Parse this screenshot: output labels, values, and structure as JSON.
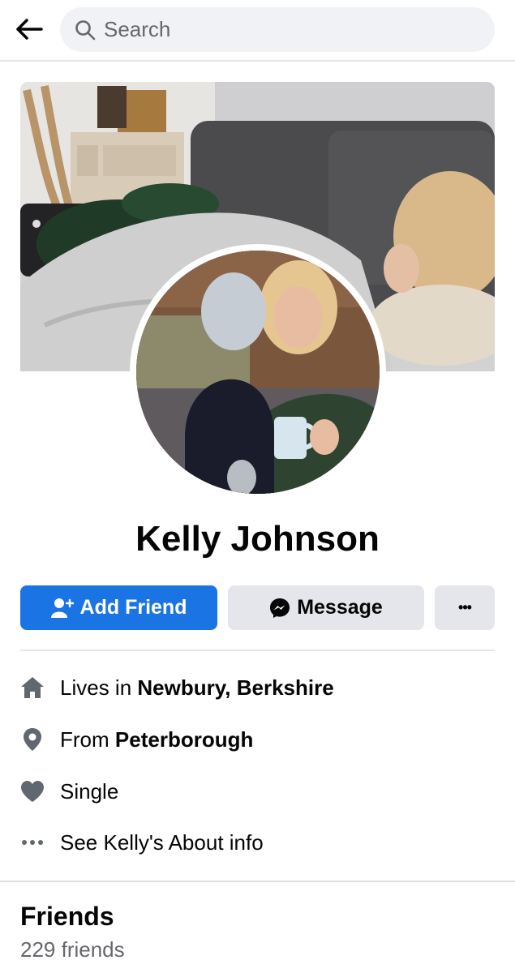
{
  "search": {
    "placeholder": "Search"
  },
  "profile": {
    "name": "Kelly Johnson"
  },
  "actions": {
    "add_friend_label": "Add Friend",
    "message_label": "Message",
    "more_label": "•••"
  },
  "intro": {
    "lives_prefix": "Lives in",
    "lives_value": "Newbury, Berkshire",
    "from_prefix": "From",
    "from_value": "Peterborough",
    "relationship": "Single",
    "about_link": "See Kelly's About info"
  },
  "friends": {
    "title": "Friends",
    "count_text": "229 friends"
  },
  "colors": {
    "primary_blue": "#1b74e4",
    "secondary_button": "#e4e6eb",
    "muted_text": "#65676b",
    "icon_gray": "#606770"
  },
  "icons": [
    "back-arrow-icon",
    "search-icon",
    "add-person-icon",
    "messenger-icon",
    "more-dots-icon",
    "home-icon",
    "location-pin-icon",
    "heart-icon",
    "ellipsis-icon"
  ]
}
